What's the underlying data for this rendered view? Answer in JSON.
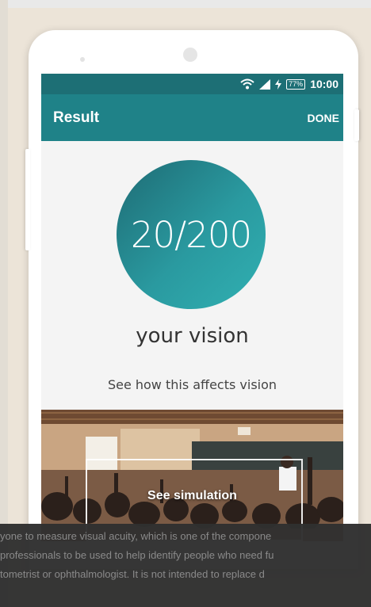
{
  "status_bar": {
    "battery": "77%",
    "time": "10:00"
  },
  "app_bar": {
    "title": "Result",
    "action": "DONE"
  },
  "result": {
    "score": "20/200",
    "caption": "your vision"
  },
  "simulation": {
    "prompt": "See how this affects vision",
    "button_label": "See simulation"
  },
  "overlay_text": [
    "yone to measure visual acuity, which is one of the compone",
    "professionals to be used to help identify people who need fu",
    "tometrist or ophthalmologist. It is not intended to replace d"
  ],
  "colors": {
    "status_bar": "#1d6f75",
    "app_bar": "#1f8288",
    "accent": "#2a9aa0"
  }
}
